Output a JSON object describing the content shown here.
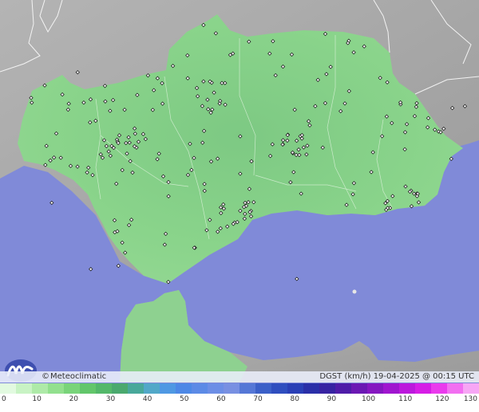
{
  "credit": {
    "symbol": "©",
    "brand": "Meteoclimatic"
  },
  "info": {
    "variable": "DGST",
    "unit": "(km/h)",
    "date": "19-04-2025",
    "time": "@ 00:15 UTC"
  },
  "legend": {
    "ticks": [
      "0",
      "10",
      "20",
      "30",
      "40",
      "50",
      "60",
      "70",
      "80",
      "90",
      "100",
      "110",
      "120",
      "130"
    ],
    "colors": [
      "#e2fae0",
      "#c8f3c4",
      "#aeeaa8",
      "#92e08e",
      "#79d47a",
      "#62c66b",
      "#53b86a",
      "#4aa96e",
      "#48a89a",
      "#51a8c8",
      "#4f98e3",
      "#4d88e6",
      "#5c8ae6",
      "#6c8ee6",
      "#7890e2",
      "#5577d6",
      "#3b5fc8",
      "#2f4ebf",
      "#2a3fb6",
      "#2a2fa8",
      "#3723a2",
      "#4f1ca8",
      "#6b18b3",
      "#8517c0",
      "#a016cf",
      "#bc18dc",
      "#d61de6",
      "#ea3aed",
      "#f26ff1",
      "#f7a6f5"
    ],
    "colors_meaning": "wind gust color scale from low (light green) to high (pink)"
  },
  "map": {
    "land_color": "#a7a7a7",
    "region_color": "#86d188",
    "sea_color": "#808ad8",
    "station_count": 230
  },
  "icons": {
    "logo": "meteoclimatic-logo-icon",
    "station": "station-marker-icon"
  }
}
